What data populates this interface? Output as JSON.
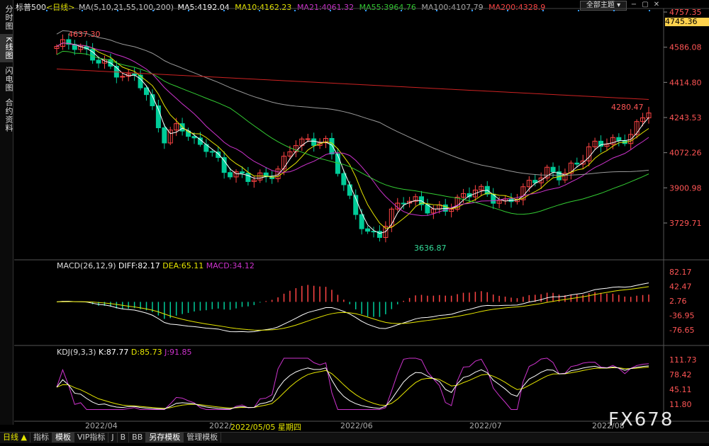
{
  "sidebar": {
    "tabs": [
      {
        "label": "分时图",
        "active": false
      },
      {
        "label": "K线图",
        "active": true
      },
      {
        "label": "闪电图",
        "active": false
      },
      {
        "label": "合约资料",
        "active": false
      }
    ]
  },
  "header": {
    "symbol": "标普500",
    "period": "<日线>",
    "ma_label": "MA(5,10,21,55,100,200)",
    "ma5": "MA5:4192.04",
    "ma10": "MA10:4162.23",
    "ma21": "MA21:4061.32",
    "ma55": "MA55:3964.76",
    "ma100": "MA100:4107.79",
    "ma200": "MA200:4328.9",
    "theme_select": "全部主题",
    "price_tag": "4745.36"
  },
  "macd_header": {
    "label": "MACD(26,12,9)",
    "diff": "DIFF:82.17",
    "dea": "DEA:65.11",
    "macd": "MACD:34.12"
  },
  "kdj_header": {
    "label": "KDJ(9,3,3)",
    "k": "K:87.77",
    "d": "D:85.73",
    "j": "J:91.85"
  },
  "annotations": {
    "high": "4637.30",
    "low": "3636.87",
    "last": "4280.47"
  },
  "axes": {
    "price": [
      "4757.35",
      "4586.08",
      "4414.80",
      "4243.53",
      "4072.26",
      "3900.98",
      "3729.71"
    ],
    "macd": [
      "82.17",
      "42.47",
      "2.76",
      "-36.95",
      "-76.65"
    ],
    "kdj": [
      "111.73",
      "78.42",
      "45.11",
      "11.80"
    ]
  },
  "dates": {
    "d1": "2022/04",
    "d2": "2022/",
    "d2b": "2022/05/05 星期四",
    "d3": "2022/06",
    "d4": "2022/07",
    "d5": "2022/08"
  },
  "bottom_tabs": [
    "日线 ▲",
    "指标",
    "模板",
    "VIP指标",
    "J",
    "B",
    "BB",
    "另存模板",
    "管理模板"
  ],
  "watermark": "FX678",
  "colors": {
    "up": "#ff4444",
    "down": "#00cc99",
    "ma5": "#ffffff",
    "ma10": "#e6e600",
    "ma21": "#cc33cc",
    "ma55": "#33cc33",
    "ma100": "#999999",
    "ma200": "#cc2222"
  }
}
